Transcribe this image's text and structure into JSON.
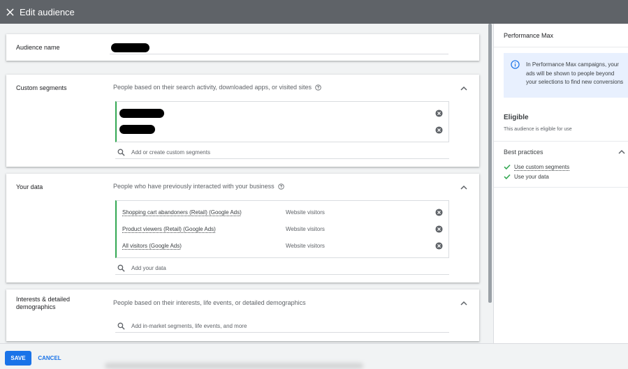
{
  "header": {
    "title": "Edit audience"
  },
  "audience_name": {
    "label": "Audience name"
  },
  "custom_segments": {
    "label": "Custom segments",
    "description": "People based on their search activity, downloaded apps, or visited sites",
    "search_placeholder": "Add or create custom segments"
  },
  "your_data": {
    "label": "Your data",
    "description": "People who have previously interacted with your business",
    "items": [
      {
        "name": "Shopping cart abandoners (Retail) (Google Ads)",
        "type": "Website visitors"
      },
      {
        "name": "Product viewers (Retail) (Google Ads)",
        "type": "Website visitors"
      },
      {
        "name": "All visitors (Google Ads)",
        "type": "Website visitors"
      }
    ],
    "search_placeholder": "Add your data"
  },
  "interests": {
    "label": "Interests & detailed demographics",
    "description": "People based on their interests, life events, or detailed demographics",
    "search_placeholder": "Add in-market segments, life events, and more"
  },
  "footer": {
    "save_label": "SAVE",
    "cancel_label": "CANCEL"
  },
  "side_panel": {
    "title": "Performance Max",
    "info": "In Performance Max campaigns, your ads will be shown to people beyond your selections to find new conversions",
    "status_title": "Eligible",
    "status_sub": "This audience is eligible for use",
    "best_practices_title": "Best practices",
    "best_practices": [
      "Use custom segments",
      "Use your data"
    ]
  },
  "colors": {
    "accent": "#1a73e8",
    "success": "#34a853",
    "header_bg": "#5f6368",
    "info_bg": "#e8f0fe"
  }
}
